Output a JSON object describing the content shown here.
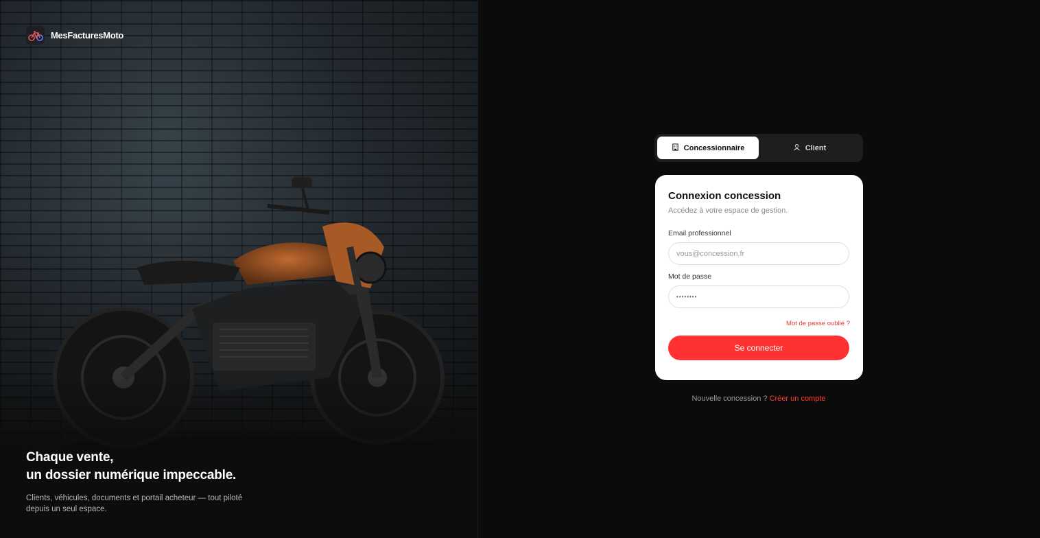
{
  "brand": {
    "name": "MesFacturesMoto",
    "logo_icon": "bicycle-icon"
  },
  "hero": {
    "title_line1": "Chaque vente,",
    "title_line2": "un dossier numérique impeccable.",
    "subtitle_line1": "Clients, véhicules, documents et portail acheteur — tout piloté",
    "subtitle_line2": "depuis un seul espace."
  },
  "tabs": [
    {
      "label": "Concessionnaire",
      "icon": "building-icon",
      "active": true
    },
    {
      "label": "Client",
      "icon": "user-icon",
      "active": false
    }
  ],
  "login": {
    "title": "Connexion concession",
    "subtitle": "Accédez à votre espace de gestion.",
    "email_label": "Email professionnel",
    "email_placeholder": "vous@concession.fr",
    "password_label": "Mot de passe",
    "password_value": "••••••••",
    "forgot_label": "Mot de passe oublié ?",
    "submit_label": "Se connecter"
  },
  "signup": {
    "prompt": "Nouvelle concession ?",
    "link_label": "Créer un compte"
  },
  "colors": {
    "accent": "#ff3131",
    "background": "#0b0b0b",
    "card": "#ffffff"
  }
}
